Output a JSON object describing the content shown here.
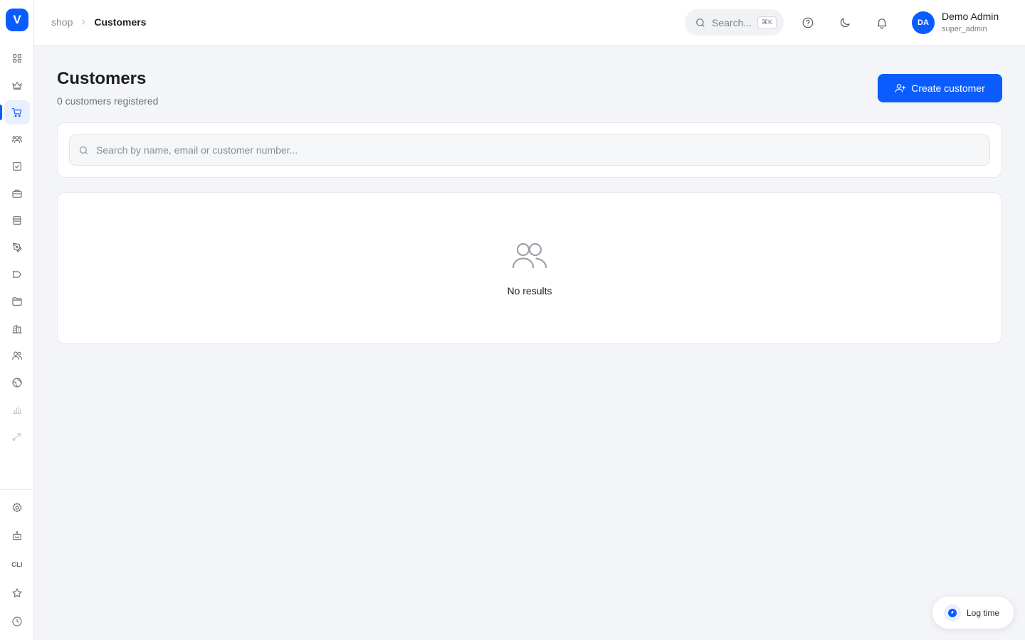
{
  "app": {
    "logo_letter": "V",
    "accent_color": "#0b5cff"
  },
  "sidebar": {
    "items": [
      {
        "icon": "dashboard-grid-icon"
      },
      {
        "icon": "crown-icon"
      },
      {
        "icon": "shopping-cart-icon",
        "active": true
      },
      {
        "icon": "users-group-icon"
      },
      {
        "icon": "checkbox-icon"
      },
      {
        "icon": "briefcase-icon"
      },
      {
        "icon": "storefront-icon"
      },
      {
        "icon": "pen-tool-icon"
      },
      {
        "icon": "megaphone-icon"
      },
      {
        "icon": "folder-icon"
      },
      {
        "icon": "buildings-icon"
      },
      {
        "icon": "contacts-icon"
      },
      {
        "icon": "globe-icon"
      },
      {
        "icon": "bar-chart-icon",
        "disabled": true
      },
      {
        "icon": "workflow-icon",
        "disabled": true
      }
    ],
    "bottom_items": [
      {
        "icon": "settings-gear-icon"
      },
      {
        "icon": "robot-icon"
      },
      {
        "label": "CLI"
      },
      {
        "icon": "star-icon"
      },
      {
        "icon": "clock-icon"
      }
    ]
  },
  "header": {
    "breadcrumb": {
      "parent": "shop",
      "current": "Customers"
    },
    "search": {
      "placeholder": "Search...",
      "shortcut": "⌘K"
    },
    "icons": [
      "help-circle-icon",
      "moon-icon",
      "bell-icon"
    ],
    "user": {
      "initials": "DA",
      "name": "Demo Admin",
      "role": "super_admin"
    }
  },
  "page": {
    "title": "Customers",
    "subtitle": "0 customers registered",
    "create_button": "Create customer",
    "search_placeholder": "Search by name, email or customer number...",
    "empty_state": "No results"
  },
  "floating": {
    "log_time_label": "Log time"
  }
}
